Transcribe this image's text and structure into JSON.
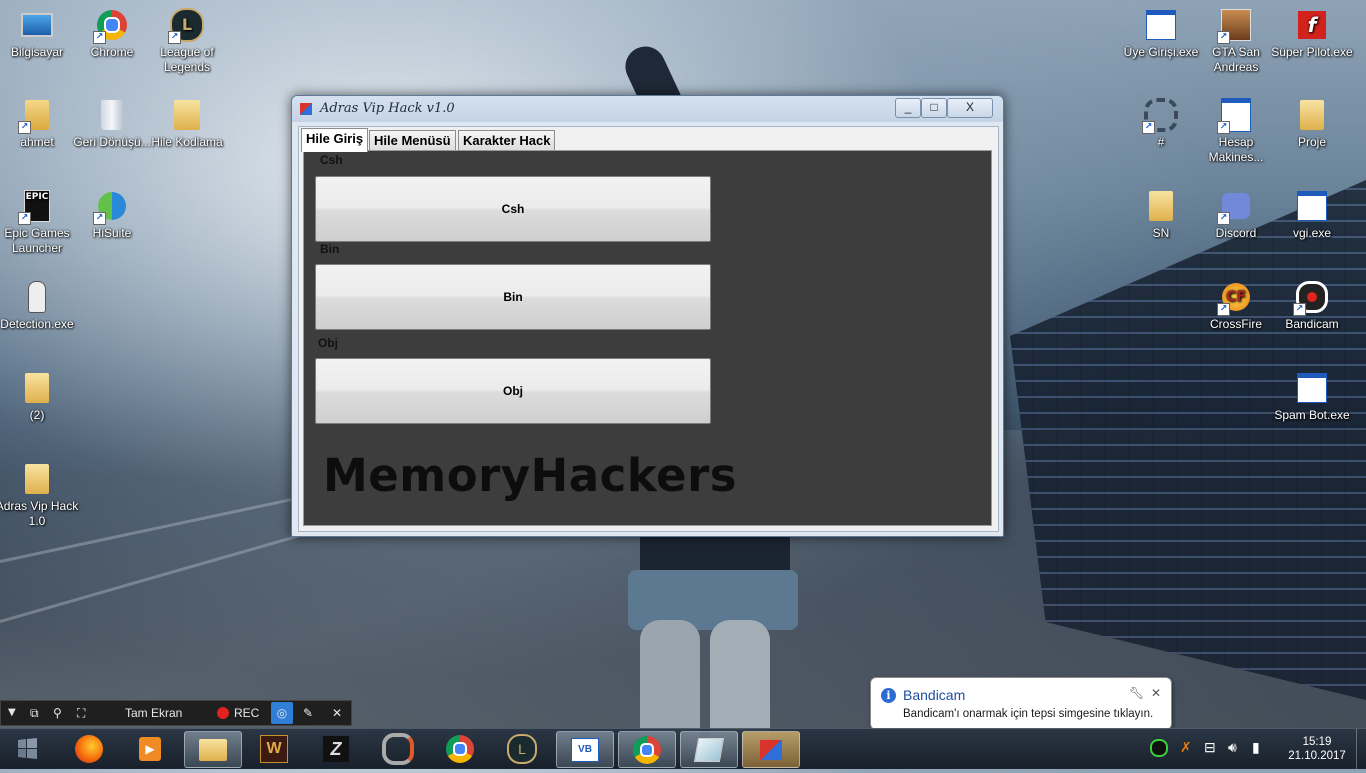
{
  "desktop": {
    "icons": [
      {
        "label": "Bilgisayar"
      },
      {
        "label": "Chrome"
      },
      {
        "label": "League of Legends"
      },
      {
        "label": "ahmet"
      },
      {
        "label": "Geri Dönüşü..."
      },
      {
        "label": "Hile Kodlama"
      },
      {
        "label": "Epic Games Launcher"
      },
      {
        "label": "HiSuite"
      },
      {
        "label": "Detection.exe"
      },
      {
        "label": "(2)"
      },
      {
        "label": "Adras Vip Hack 1.0"
      },
      {
        "label": "Üye Girişi.exe"
      },
      {
        "label": "GTA San Andreas"
      },
      {
        "label": "Süper Pilot.exe"
      },
      {
        "label": "#"
      },
      {
        "label": "Hesap Makines..."
      },
      {
        "label": "Proje"
      },
      {
        "label": "SN"
      },
      {
        "label": "Discord"
      },
      {
        "label": "vgi.exe"
      },
      {
        "label": "CrossFire"
      },
      {
        "label": "Bandicam"
      },
      {
        "label": "Spam Bot.exe"
      }
    ]
  },
  "app_window": {
    "title": "Adras Vip Hack v1.0",
    "controls": {
      "minimize": "_",
      "maximize": "□",
      "close": "X"
    },
    "tabs": [
      {
        "label": "Hile Giriş",
        "active": true
      },
      {
        "label": "Hile Menüsü",
        "active": false
      },
      {
        "label": "Karakter Hack",
        "active": false
      }
    ],
    "groups": [
      {
        "label": "Csh",
        "button": "Csh"
      },
      {
        "label": "Bin",
        "button": "Bin"
      },
      {
        "label": "Obj",
        "button": "Obj"
      }
    ],
    "brand_text": "MemoryHackers"
  },
  "bandicam_toolbar": {
    "fullscreen_label": "Tam Ekran",
    "rec_label": "REC"
  },
  "notification": {
    "title": "Bandicam",
    "message": "Bandicam'ı onarmak için tepsi simgesine tıklayın."
  },
  "taskbar": {
    "time": "15:19",
    "date": "21.10.2017"
  },
  "colors": {
    "panel_bg": "#3d3d3d",
    "title_blue": "#1f4fa3",
    "rec_red": "#e0231e"
  }
}
